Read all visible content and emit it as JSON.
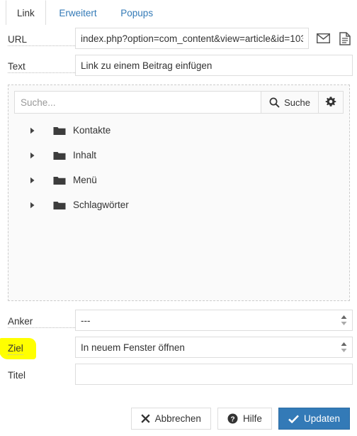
{
  "dialog": {
    "tabs": [
      {
        "label": "Link",
        "active": true
      },
      {
        "label": "Erweitert",
        "active": false
      },
      {
        "label": "Popups",
        "active": false
      }
    ]
  },
  "fields": {
    "url": {
      "label": "URL",
      "value": "index.php?option=com_content&view=article&id=103 …",
      "placeholder": "",
      "mail_icon": "envelope-icon",
      "doc_icon": "document-icon"
    },
    "text": {
      "label": "Text",
      "value": "Link zu einem Beitrag einfügen",
      "placeholder": ""
    },
    "anker": {
      "label": "Anker",
      "value": "---",
      "options": [
        "---"
      ]
    },
    "ziel": {
      "label": "Ziel",
      "value": "In neuem Fenster öffnen",
      "options": [
        "In neuem Fenster öffnen"
      ],
      "highlight_color": "#ffff00",
      "highlighted": true
    },
    "titel": {
      "label": "Titel",
      "value": "",
      "placeholder": ""
    }
  },
  "browser_panel": {
    "search": {
      "placeholder": "Suche...",
      "value": "",
      "button_label": "Suche",
      "search_icon": "magnifier-icon",
      "settings_icon": "gear-icon"
    },
    "tree": [
      {
        "label": "Kontakte",
        "expanded": false
      },
      {
        "label": "Inhalt",
        "expanded": false
      },
      {
        "label": "Menü",
        "expanded": false
      },
      {
        "label": "Schlagwörter",
        "expanded": false
      }
    ]
  },
  "footer": {
    "cancel": {
      "label": "Abbrechen",
      "icon": "close-x-icon"
    },
    "help": {
      "label": "Hilfe",
      "icon": "question-circle-icon"
    },
    "update": {
      "label": "Updaten",
      "icon": "check-icon",
      "color": "#337ab7"
    }
  }
}
